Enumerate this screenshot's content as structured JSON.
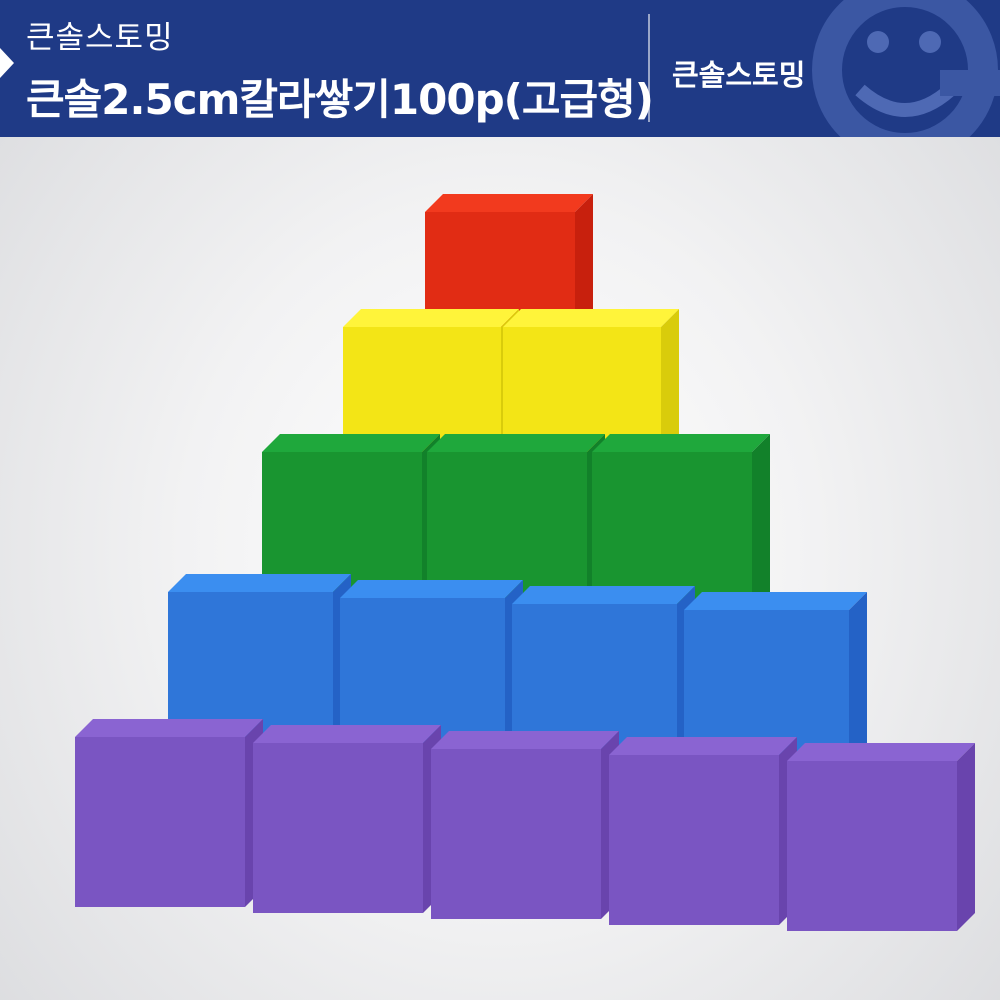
{
  "banner": {
    "brand_small": "큰솔스토밍",
    "product_title": "큰솔2.5cm칼라쌓기100p(고급형)",
    "brand_right": "큰솔스토밍",
    "background_color": "#1f3a86",
    "logo_icon": "smiling-g-logo-icon"
  },
  "photo": {
    "subject": "color-cube-pyramid",
    "rows": [
      {
        "color": "red",
        "count": 1
      },
      {
        "color": "yellow",
        "count": 2
      },
      {
        "color": "green",
        "count": 3
      },
      {
        "color": "blue",
        "count": 4
      },
      {
        "color": "purple",
        "count": 5
      }
    ],
    "colors": {
      "red": [
        "#f23a1e",
        "#c8200d",
        "#e12c14"
      ],
      "yellow": [
        "#fff43a",
        "#d9cc0b",
        "#f3e516"
      ],
      "green": [
        "#1fa83c",
        "#12812a",
        "#199530"
      ],
      "blue": [
        "#3b8ef0",
        "#2462c6",
        "#2f76d9"
      ],
      "purple": [
        "#8a64d2",
        "#6944ad",
        "#7a55c2"
      ]
    }
  }
}
